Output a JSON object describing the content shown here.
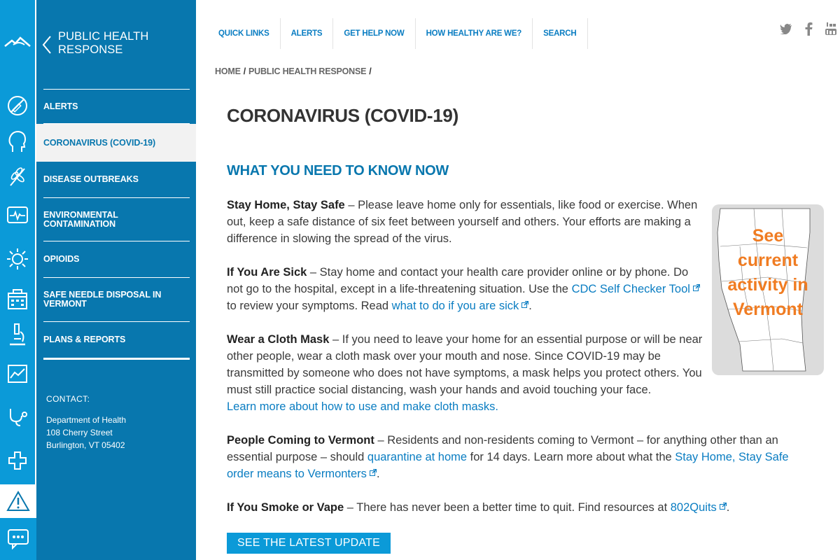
{
  "sidebar": {
    "title": "PUBLIC HEALTH RESPONSE",
    "items": [
      {
        "label": "ALERTS"
      },
      {
        "label": "CORONAVIRUS (COVID-19)"
      },
      {
        "label": "DISEASE OUTBREAKS"
      },
      {
        "label": "ENVIRONMENTAL CONTAMINATION"
      },
      {
        "label": "OPIOIDS"
      },
      {
        "label": "SAFE NEEDLE DISPOSAL IN VERMONT"
      },
      {
        "label": "PLANS & REPORTS"
      }
    ],
    "contact": {
      "label": "CONTACT:",
      "org": "Department of Health",
      "street": "108 Cherry Street",
      "city": "Burlington, VT 05402"
    }
  },
  "topnav": {
    "items": [
      "QUICK LINKS",
      "ALERTS",
      "GET HELP NOW",
      "HOW HEALTHY ARE WE?",
      "SEARCH"
    ]
  },
  "social": [
    "twitter-icon",
    "facebook-icon",
    "youtube-icon"
  ],
  "breadcrumb": {
    "home": "HOME",
    "section": "PUBLIC HEALTH RESPONSE",
    "sep": "/"
  },
  "main": {
    "title": "CORONAVIRUS (COVID-19)",
    "section_title": "WHAT YOU NEED TO KNOW NOW",
    "stay_home": {
      "heading": "Stay Home, Stay Safe",
      "text": " – Please leave home only for essentials, like food or exercise. When out, keep a safe distance of six feet between yourself and others. Your efforts are making a difference in slowing the spread of the virus."
    },
    "if_sick": {
      "heading": "If You Are Sick",
      "text1": " – Stay home and contact your health care provider online or by phone. Do not go to the hospital, except in a life-threatening situation. Use the ",
      "link1": "CDC Self Checker Tool",
      "text2": " to review your symptoms. Read ",
      "link2": "what to do if you are sick",
      "text3": "."
    },
    "mask": {
      "heading": "Wear a Cloth Mask",
      "text": " – If you need to leave your home for an essential purpose or will be near other people, wear a cloth mask over your mouth and nose. Since COVID-19 may be transmitted by someone who does not have symptoms, a mask helps you protect others. You must still practice social distancing, wash your hands and avoid touching your face.",
      "link": "Learn more about how to use and make cloth masks."
    },
    "coming": {
      "heading": "People Coming to Vermont",
      "text1": " – Residents and non-residents coming to Vermont – for anything other than an essential purpose – should ",
      "link1": "quarantine at home",
      "text2": " for 14 days. Learn more about what the ",
      "link2": "Stay Home, Stay Safe order means to Vermonters",
      "text3": "."
    },
    "smoke": {
      "heading": "If You Smoke or Vape",
      "text1": " – There has never been a better time to quit. Find resources at ",
      "link": "802Quits",
      "text2": "."
    },
    "cta": "SEE THE LATEST UPDATE",
    "promo": {
      "line1": "See",
      "line2": "current",
      "line3": "activity in",
      "line4": "Vermont"
    }
  },
  "colors": {
    "brand_blue": "#0b9ad8",
    "sidebar_blue": "#0877ae",
    "link_blue": "#0a7dc2",
    "promo_orange": "#f07c22"
  },
  "rail_icons": [
    "logo-icon",
    "no-smoking-icon",
    "head-icon",
    "leaf-icon",
    "heart-monitor-icon",
    "sun-icon",
    "building-icon",
    "microscope-icon",
    "chart-icon",
    "stethoscope-icon",
    "plus-icon",
    "warning-icon",
    "chat-icon"
  ]
}
